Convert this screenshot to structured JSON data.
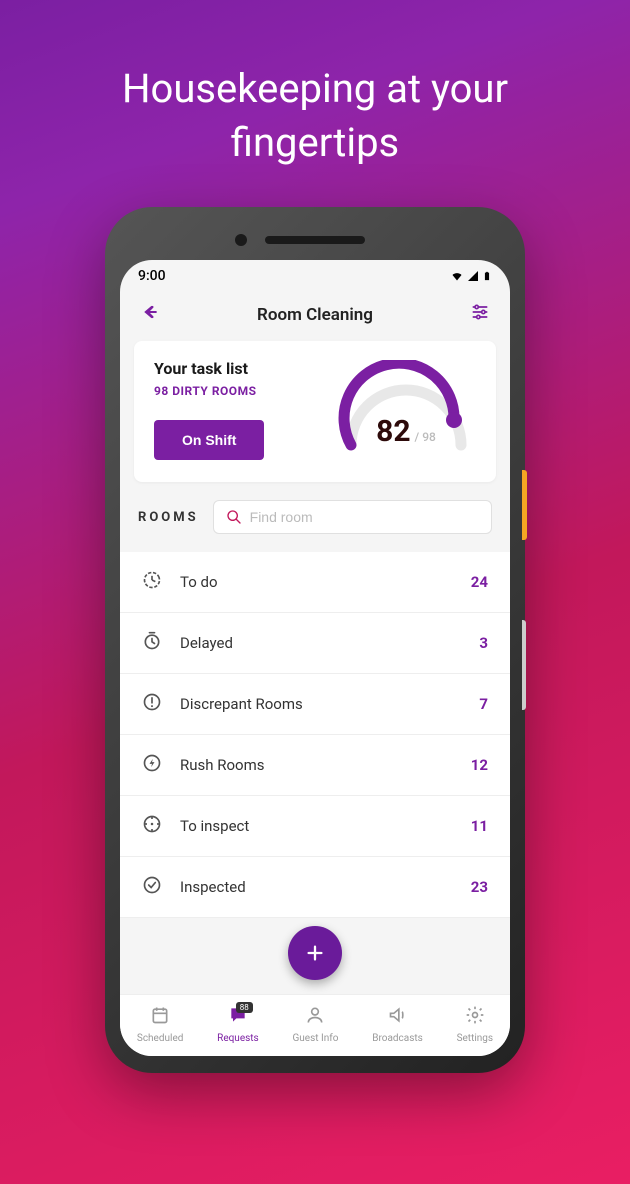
{
  "headline": "Housekeeping at your fingertips",
  "status": {
    "time": "9:00"
  },
  "header": {
    "title": "Room Cleaning"
  },
  "task_card": {
    "title": "Your task list",
    "subtitle": "98 DIRTY ROOMS",
    "button": "On Shift",
    "gauge_value": "82",
    "gauge_max": "/ 98"
  },
  "rooms": {
    "label": "ROOMS",
    "search_placeholder": "Find room"
  },
  "list": [
    {
      "icon": "todo",
      "label": "To do",
      "count": "24"
    },
    {
      "icon": "delayed",
      "label": "Delayed",
      "count": "3"
    },
    {
      "icon": "discrepant",
      "label": "Discrepant Rooms",
      "count": "7"
    },
    {
      "icon": "rush",
      "label": "Rush Rooms",
      "count": "12"
    },
    {
      "icon": "inspect",
      "label": "To inspect",
      "count": "11"
    },
    {
      "icon": "inspected",
      "label": "Inspected",
      "count": "23"
    }
  ],
  "nav": {
    "scheduled": "Scheduled",
    "requests": "Requests",
    "requests_badge": "88",
    "guest": "Guest Info",
    "broadcasts": "Broadcasts",
    "settings": "Settings"
  }
}
